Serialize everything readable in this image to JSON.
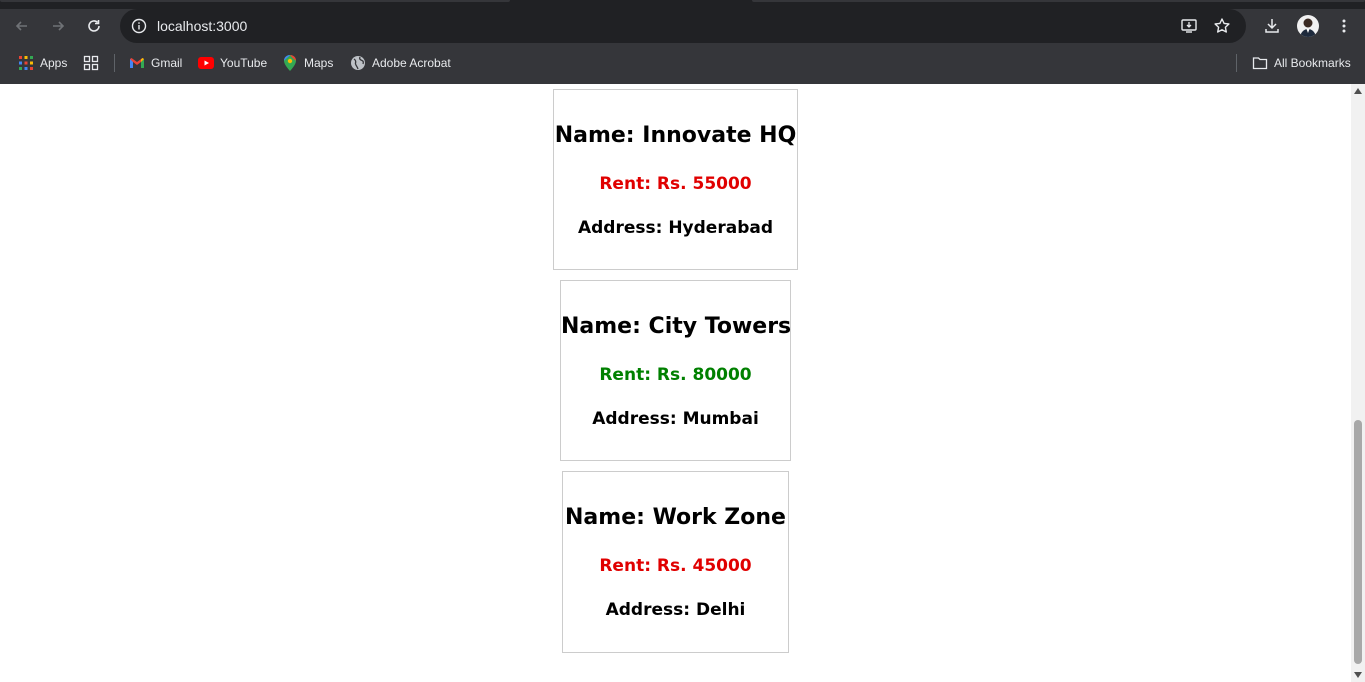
{
  "browser": {
    "url": "localhost:3000",
    "icons": {
      "back": "arrow-left-icon",
      "forward": "arrow-right-icon",
      "reload": "reload-icon",
      "site_info": "info-icon",
      "install": "install-app-icon",
      "bookmark": "star-icon",
      "downloads": "download-icon",
      "menu": "kebab-menu-icon"
    }
  },
  "bookmarks": {
    "items": [
      {
        "label": "Apps",
        "icon": "apps-grid-icon"
      },
      {
        "label": "",
        "icon": "tab-groups-icon"
      },
      {
        "label": "Gmail",
        "icon": "gmail-icon"
      },
      {
        "label": "YouTube",
        "icon": "youtube-icon"
      },
      {
        "label": "Maps",
        "icon": "maps-pin-icon"
      },
      {
        "label": "Adobe Acrobat",
        "icon": "globe-icon"
      }
    ],
    "all_bookmarks": "All Bookmarks"
  },
  "cards": [
    {
      "name": "Name: Innovate HQ",
      "rent": "Rent: Rs. 55000",
      "address": "Address: Hyderabad",
      "rent_color": "#e00000"
    },
    {
      "name": "Name: City Towers",
      "rent": "Rent: Rs. 80000",
      "address": "Address: Mumbai",
      "rent_color": "#008000"
    },
    {
      "name": "Name: Work Zone",
      "rent": "Rent: Rs. 45000",
      "address": "Address: Delhi",
      "rent_color": "#e00000"
    }
  ],
  "colors": {
    "chrome_dark": "#202124",
    "chrome_toolbar": "#35363a",
    "text_light": "#e8eaed",
    "rent_high": "#008000",
    "rent_low": "#e00000"
  }
}
